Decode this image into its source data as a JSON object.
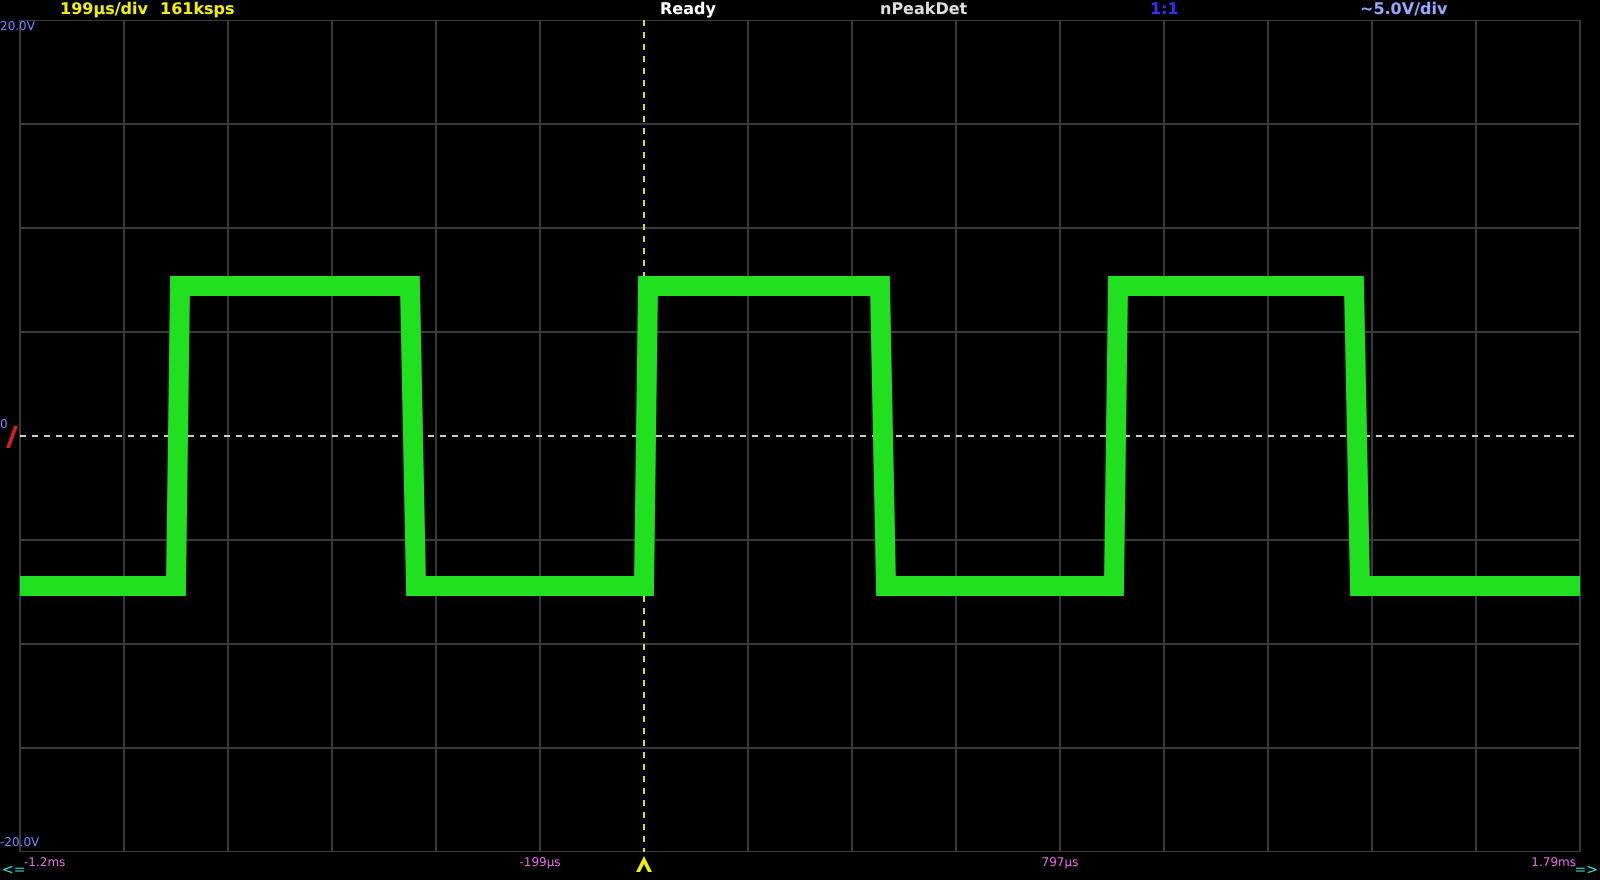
{
  "status_bar": {
    "timebase": "199µs/div",
    "sample_rate": "161ksps",
    "state": "Ready",
    "acquisition": "nPeakDet",
    "probe": "1:1",
    "vertical_scale": "~5.0V/div"
  },
  "plot": {
    "y_top_label": "20.0V",
    "y_bottom_label": "-20.0V",
    "zero_label": "0"
  },
  "time_axis": {
    "scroll_left": "<=",
    "labels": [
      "-1.2ms",
      "-199µs",
      "797µs",
      "1.79ms"
    ],
    "scroll_right": "=>"
  }
}
